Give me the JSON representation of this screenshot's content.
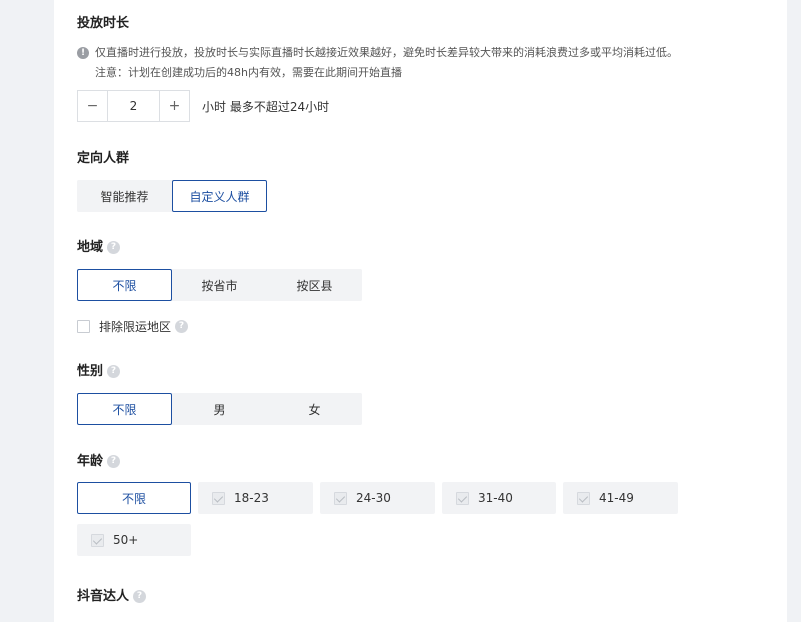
{
  "duration": {
    "title": "投放时长",
    "info_line1": "仅直播时进行投放，投放时长与实际直播时长越接近效果越好，避免时长差异较大带来的消耗浪费过多或平均消耗过低。",
    "info_line2": "注意：计划在创建成功后的48h内有效，需要在此期间开始直播",
    "minus": "−",
    "plus": "+",
    "value": "2",
    "hint": "小时 最多不超过24小时"
  },
  "audience": {
    "title": "定向人群",
    "options": [
      "智能推荐",
      "自定义人群"
    ],
    "selected": "自定义人群"
  },
  "region": {
    "title": "地域",
    "options": [
      "不限",
      "按省市",
      "按区县"
    ],
    "selected": "不限",
    "exclude_label": "排除限运地区"
  },
  "gender": {
    "title": "性别",
    "options": [
      "不限",
      "男",
      "女"
    ],
    "selected": "不限"
  },
  "age": {
    "title": "年龄",
    "options": [
      "不限",
      "18-23",
      "24-30",
      "31-40",
      "41-49",
      "50+"
    ],
    "selected": "不限"
  },
  "douyin_influencer": {
    "title": "抖音达人"
  },
  "icons": {
    "help": "?",
    "info": "!"
  }
}
